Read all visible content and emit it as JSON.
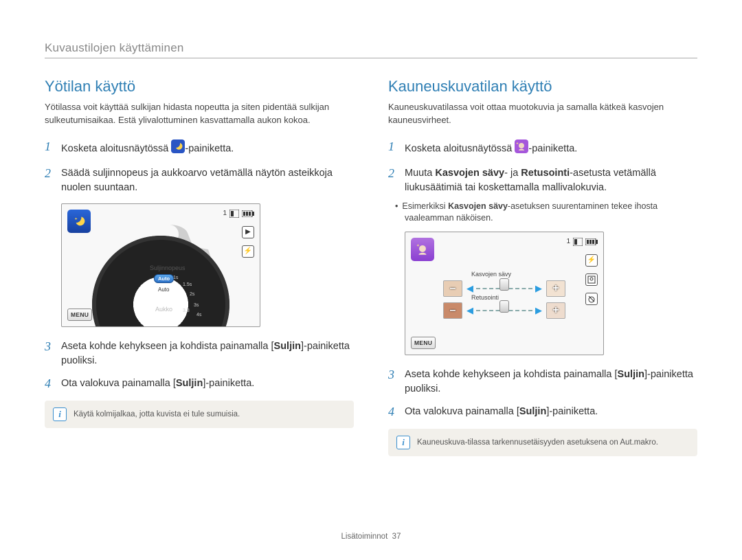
{
  "chapter": "Kuvaustilojen käyttäminen",
  "footer": {
    "label": "Lisätoiminnot",
    "page": "37"
  },
  "left": {
    "title": "Yötilan käyttö",
    "intro": "Yötilassa voit käyttää sulkijan hidasta nopeutta ja siten pidentää sulkijan sulkeutumisaikaa. Estä ylivalottuminen kasvattamalla aukon kokoa.",
    "steps": [
      {
        "n": "1",
        "body_a": "Kosketa aloitusnäytössä ",
        "body_b": "-painiketta."
      },
      {
        "n": "2",
        "body": "Säädä suljinnopeus ja aukkoarvo vetämällä näytön asteikkoja nuolen suuntaan."
      },
      {
        "n": "3",
        "body_a": "Aseta kohde kehykseen ja kohdista painamalla [",
        "bold": "Suljin",
        "body_b": "]-painiketta puoliksi."
      },
      {
        "n": "4",
        "body_a": "Ota valokuva painamalla [",
        "bold": "Suljin",
        "body_b": "]-painiketta."
      }
    ],
    "note": "Käytä kolmijalkaa, jotta kuvista ei tule sumuisia.",
    "screenshot": {
      "top_count": "1",
      "menu": "MENU",
      "label_shutter": "Suljinnopeus",
      "label_aperture": "Aukko",
      "auto_chip": "Auto",
      "auto_inner": "Auto",
      "ticks": [
        "1s",
        "1.5s",
        "2s",
        "3s",
        "4s",
        "3.3"
      ]
    }
  },
  "right": {
    "title": "Kauneuskuvatilan käyttö",
    "intro": "Kauneuskuvatilassa voit ottaa muotokuvia ja samalla kätkeä kasvojen kauneusvirheet.",
    "steps": [
      {
        "n": "1",
        "body_a": "Kosketa aloitusnäytössä ",
        "body_b": "-painiketta."
      },
      {
        "n": "2",
        "body_a": "Muuta ",
        "bold1": "Kasvojen sävy",
        "mid": "- ja ",
        "bold2": "Retusointi",
        "body_b": "-asetusta vetämällä liukusäätimiä tai koskettamalla mallivalokuvia."
      },
      {
        "n": "3",
        "body_a": "Aseta kohde kehykseen ja kohdista painamalla [",
        "bold": "Suljin",
        "body_b": "]-painiketta puoliksi."
      },
      {
        "n": "4",
        "body_a": "Ota valokuva painamalla [",
        "bold": "Suljin",
        "body_b": "]-painiketta."
      }
    ],
    "sub": {
      "pre": "Esimerkiksi ",
      "bold": "Kasvojen sävy",
      "post": "-asetuksen suurentaminen tekee ihosta vaaleamman näköisen."
    },
    "note": "Kauneuskuva-tilassa tarkennusetäisyyden asetuksena on Aut.makro.",
    "screenshot": {
      "top_count": "1",
      "menu": "MENU",
      "label_tone": "Kasvojen sävy",
      "label_retouch": "Retusointi"
    }
  },
  "icons": {
    "right_play": "▶",
    "right_flash": "⚡"
  }
}
